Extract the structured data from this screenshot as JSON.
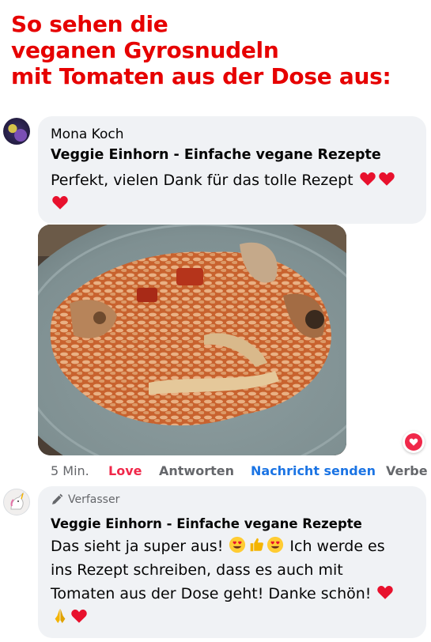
{
  "headline": {
    "lines": [
      "So sehen die",
      "veganen Gyrosnudeln",
      "mit Tomaten aus der Dose aus:"
    ]
  },
  "comment1": {
    "author": "Mona Koch",
    "page": "Veggie Einhorn - Einfache vegane Rezepte",
    "text": "Perfekt, vielen Dank für das tolle Rezept"
  },
  "actions": {
    "time": "5 Min.",
    "love": "Love",
    "reply": "Antworten",
    "message": "Nachricht senden",
    "more": "Verbe"
  },
  "comment2": {
    "badge": "Verfasser",
    "page": "Veggie Einhorn - Einfache vegane Rezepte",
    "text_line1": "Das sieht ja super aus!",
    "text_line1b": "Ich werde es",
    "text_line2": "ins Rezept schreiben, dass es auch mit",
    "text_line3": "Tomaten aus der Dose geht! Danke schön!"
  },
  "colors": {
    "headline": "#e60000",
    "bubble": "#f0f2f5",
    "love": "#f0284a",
    "link": "#1b74e4",
    "muted": "#65676b"
  },
  "icons": {
    "heart": "red-heart-icon",
    "heart_eyes": "heart-eyes-emoji-icon",
    "thumbs_up": "thumbs-up-emoji-icon",
    "folded_hands": "folded-hands-emoji-icon",
    "pencil": "pencil-icon",
    "love_reaction": "love-reaction-icon"
  }
}
